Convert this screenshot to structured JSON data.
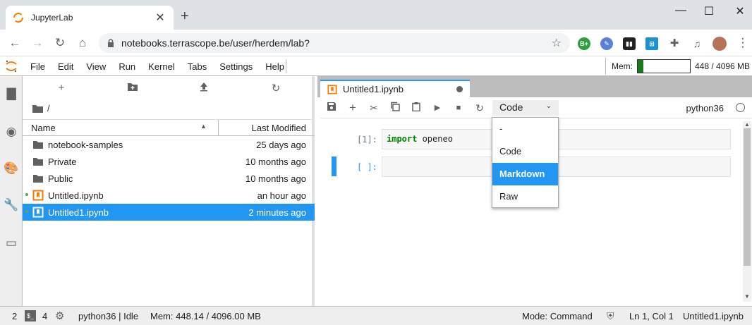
{
  "browser": {
    "tab_title": "JupyterLab",
    "tab_close": "✕",
    "new_tab": "+",
    "url": "notebooks.terrascope.be/user/herdem/lab?",
    "win_min": "—",
    "win_max": "☐",
    "win_close": "✕",
    "extension_badge": "B+"
  },
  "menubar": {
    "items": [
      "File",
      "Edit",
      "View",
      "Run",
      "Kernel",
      "Tabs",
      "Settings",
      "Help"
    ],
    "mem_label": "Mem:",
    "mem_value": "448 / 4096 MB",
    "mem_fraction": 0.11
  },
  "filebrowser": {
    "breadcrumb": "/",
    "col_name": "Name",
    "col_modified": "Last Modified",
    "rows": [
      {
        "name": "notebook-samples",
        "modified": "25 days ago",
        "type": "folder"
      },
      {
        "name": "Private",
        "modified": "10 months ago",
        "type": "folder"
      },
      {
        "name": "Public",
        "modified": "10 months ago",
        "type": "folder"
      },
      {
        "name": "Untitled.ipynb",
        "modified": "an hour ago",
        "type": "notebook"
      },
      {
        "name": "Untitled1.ipynb",
        "modified": "2 minutes ago",
        "type": "notebook"
      }
    ]
  },
  "notebook": {
    "tab_title": "Untitled1.ipynb",
    "cell_type": "Code",
    "kernel": "python36",
    "cells": [
      {
        "prompt": "[1]:",
        "keyword": "import",
        "code": " openeo"
      },
      {
        "prompt": "[ ]:",
        "keyword": "",
        "code": ""
      }
    ]
  },
  "dropdown": {
    "options": [
      "-",
      "Code",
      "Markdown",
      "Raw"
    ],
    "highlighted": "Markdown"
  },
  "statusbar": {
    "count_a": "2",
    "count_b": "4",
    "kernel_status": "python36 | Idle",
    "mem": "Mem: 448.14 / 4096.00 MB",
    "mode": "Mode: Command",
    "position": "Ln 1, Col 1",
    "file": "Untitled1.ipynb"
  },
  "colors": {
    "accent": "#2196f3",
    "mem_fill": "#1b7a1b",
    "notebook_icon": "#f57c00"
  }
}
